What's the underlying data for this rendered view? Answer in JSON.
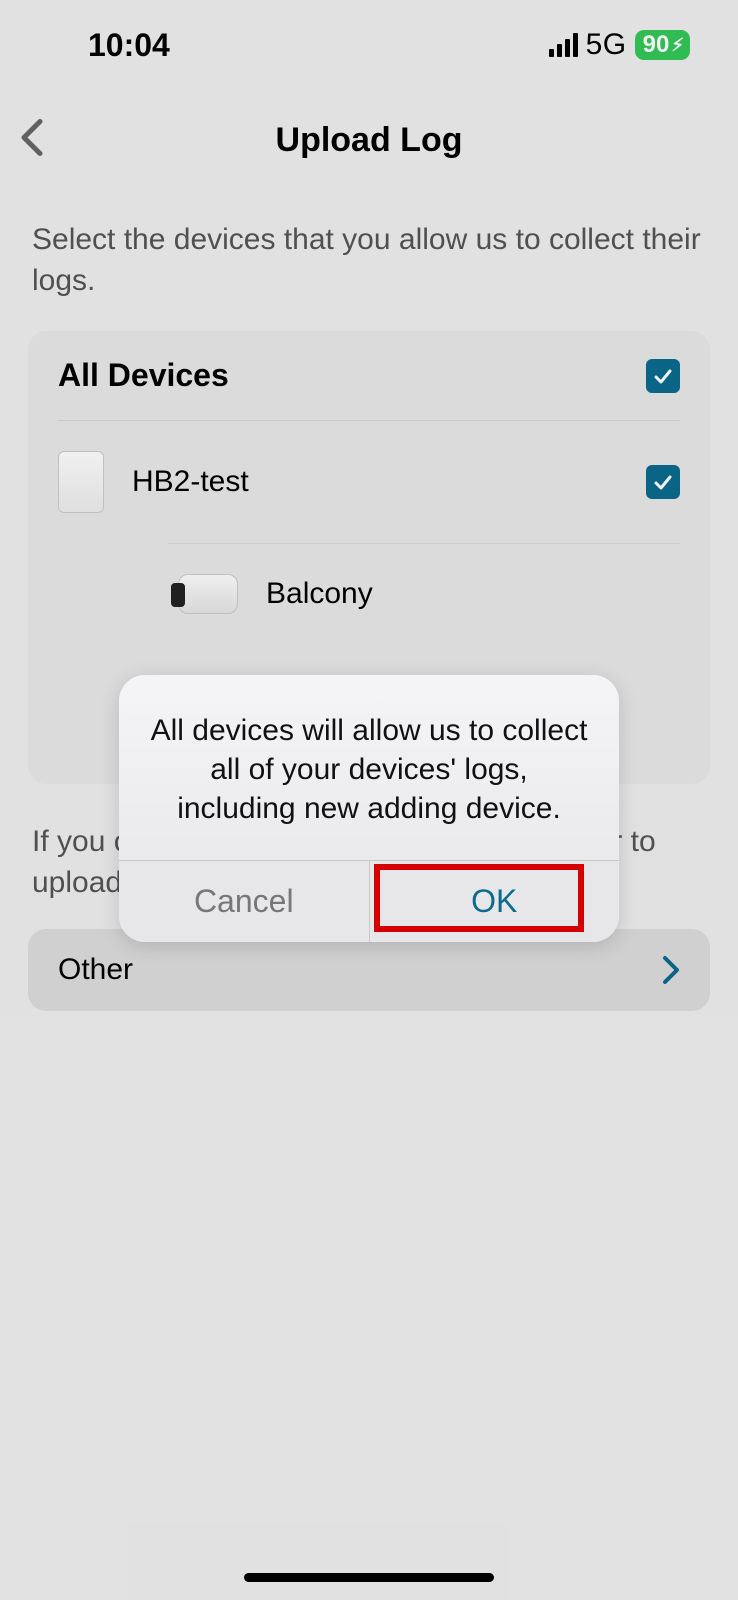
{
  "status": {
    "time": "10:04",
    "network": "5G",
    "battery": "90"
  },
  "nav": {
    "title": "Upload Log"
  },
  "instruction": "Select the devices that you allow us to collect their logs.",
  "list": {
    "all_label": "All Devices",
    "devices": [
      {
        "name": "HB2-test"
      },
      {
        "name": "Balcony"
      }
    ]
  },
  "footnote": "If you cannot find your device, click on Other to upload.",
  "other_label": "Other",
  "alert": {
    "message": "All devices will allow us to collect all of your devices' logs, including new adding device.",
    "cancel": "Cancel",
    "ok": "OK"
  }
}
